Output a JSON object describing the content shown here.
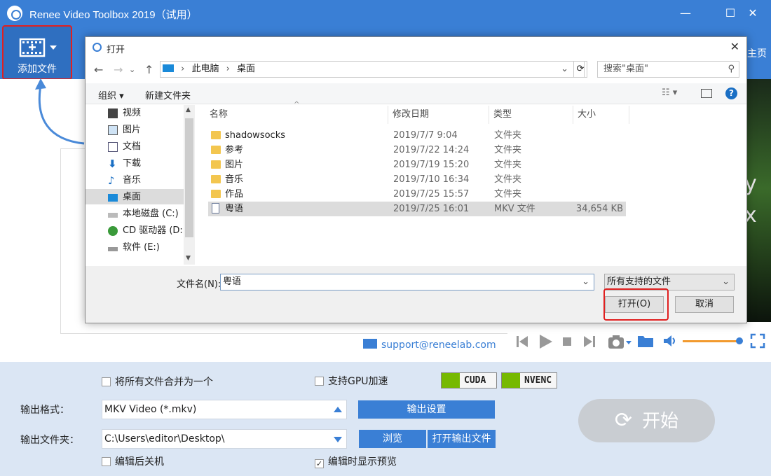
{
  "app": {
    "title": "Renee Video Toolbox 2019（试用）",
    "win_minimize": "—",
    "win_maximize": "☐",
    "win_close": "✕",
    "home_link": "主页"
  },
  "toolbar": {
    "add_file_label": "添加文件"
  },
  "preview_text": [
    "y",
    "x"
  ],
  "support_email": "support@reneelab.com",
  "bottom": {
    "merge_label": "将所有文件合并为一个",
    "merge_checked": false,
    "gpu_label": "支持GPU加速",
    "gpu_checked": false,
    "cuda": "CUDA",
    "nvenc": "NVENC",
    "format_label": "输出格式：",
    "format_value": "MKV Video (*.mkv)",
    "output_settings": "输出设置",
    "folder_label": "输出文件夹：",
    "folder_value": "C:\\Users\\editor\\Desktop\\",
    "browse": "浏览",
    "open_output": "打开输出文件",
    "shutdown_label": "编辑后关机",
    "shutdown_checked": false,
    "preview_label": "编辑时显示预览",
    "preview_checked": true,
    "start": "开始"
  },
  "dialog": {
    "title": "打开",
    "path": [
      "此电脑",
      "桌面"
    ],
    "search_placeholder": "搜索\"桌面\"",
    "organize": "组织 ▾",
    "new_folder": "新建文件夹",
    "nav_items": [
      {
        "label": "视频",
        "icon": "video-icon"
      },
      {
        "label": "图片",
        "icon": "picture-icon"
      },
      {
        "label": "文档",
        "icon": "document-icon"
      },
      {
        "label": "下载",
        "icon": "download-icon"
      },
      {
        "label": "音乐",
        "icon": "music-icon"
      },
      {
        "label": "桌面",
        "icon": "desktop-icon",
        "selected": true
      },
      {
        "label": "本地磁盘 (C:)",
        "icon": "disk-icon"
      },
      {
        "label": "CD 驱动器 (D:)",
        "icon": "cd-icon"
      },
      {
        "label": "软件 (E:)",
        "icon": "drive-icon"
      }
    ],
    "columns": {
      "name": "名称",
      "date": "修改日期",
      "type": "类型",
      "size": "大小"
    },
    "files": [
      {
        "name": "shadowsocks",
        "date": "2019/7/7 9:04",
        "type": "文件夹",
        "size": "",
        "kind": "folder"
      },
      {
        "name": "参考",
        "date": "2019/7/22 14:24",
        "type": "文件夹",
        "size": "",
        "kind": "folder"
      },
      {
        "name": "图片",
        "date": "2019/7/19 15:20",
        "type": "文件夹",
        "size": "",
        "kind": "folder"
      },
      {
        "name": "音乐",
        "date": "2019/7/10 16:34",
        "type": "文件夹",
        "size": "",
        "kind": "folder"
      },
      {
        "name": "作品",
        "date": "2019/7/25 15:57",
        "type": "文件夹",
        "size": "",
        "kind": "folder"
      },
      {
        "name": "粤语",
        "date": "2019/7/25 16:01",
        "type": "MKV 文件",
        "size": "34,654 KB",
        "kind": "file",
        "selected": true
      }
    ],
    "filename_label": "文件名(N):",
    "filename_value": "粤语",
    "filetype_value": "所有支持的文件",
    "open_button": "打开(O)",
    "cancel_button": "取消"
  },
  "colors": {
    "accent": "#3a7fd5",
    "highlight": "#e02020",
    "panel": "#dbe6f4"
  }
}
